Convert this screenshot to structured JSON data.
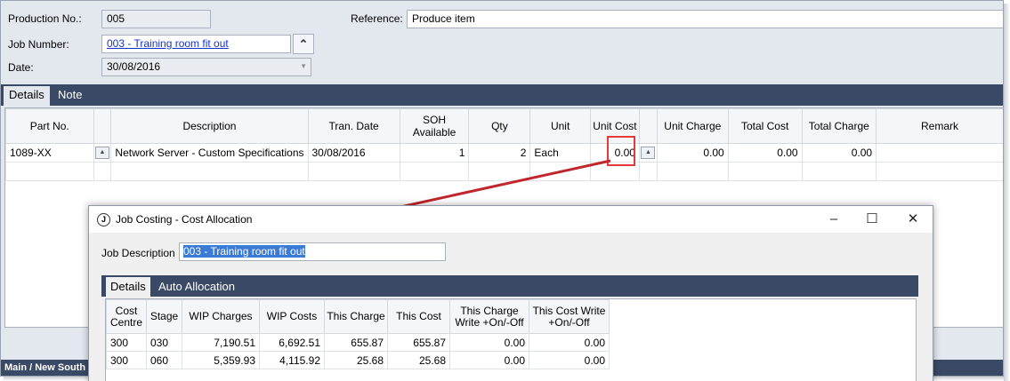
{
  "header": {
    "production_no_label": "Production No.:",
    "production_no_value": "005",
    "job_number_label": "Job Number:",
    "job_number_value": "003 - Training room fit out",
    "date_label": "Date:",
    "date_value": "30/08/2016",
    "reference_label": "Reference:",
    "reference_value": "Produce item"
  },
  "tabs": [
    {
      "label": "Details",
      "active": true
    },
    {
      "label": "Note",
      "active": false
    }
  ],
  "grid": {
    "columns": [
      "Part No.",
      "",
      "Description",
      "Tran. Date",
      "SOH Available",
      "Qty",
      "Unit",
      "Unit Cost",
      "",
      "Unit Charge",
      "Total Cost",
      "Total Charge",
      "Remark"
    ],
    "rows": [
      {
        "part_no": "1089-XX",
        "description": "Network Server - Custom Specifications",
        "tran_date": "30/08/2016",
        "soh": "1",
        "qty": "2",
        "unit": "Each",
        "unit_cost": "0.00",
        "unit_charge": "0.00",
        "total_cost": "0.00",
        "total_charge": "0.00",
        "remark": ""
      }
    ]
  },
  "bottom_bar": {
    "text": "Main / New South"
  },
  "dialog": {
    "icon": "J",
    "title": "Job Costing - Cost Allocation",
    "job_description_label": "Job Description",
    "job_description_value": "003 - Training room fit out",
    "tabs": [
      {
        "label": "Details",
        "active": true
      },
      {
        "label": "Auto Allocation",
        "active": false
      }
    ],
    "columns": [
      "Cost Centre",
      "Stage",
      "WIP Charges",
      "WIP Costs",
      "This Charge",
      "This Cost",
      "This Charge Write +On/-Off",
      "This Cost Write +On/-Off"
    ],
    "rows": [
      [
        "300",
        "030",
        "7,190.51",
        "6,692.51",
        "655.87",
        "655.87",
        "0.00",
        "0.00"
      ],
      [
        "300",
        "060",
        "5,359.93",
        "4,115.92",
        "25.68",
        "25.68",
        "0.00",
        "0.00"
      ]
    ]
  },
  "icons": {
    "collapse": "chevron-up-icon",
    "cell_button": "triangle-up-icon",
    "minimize": "minimize-icon",
    "maximize": "maximize-icon",
    "close": "close-icon"
  },
  "colors": {
    "tab_bar": "#3a4a66",
    "highlight": "#e23b3b",
    "arrow": "#c0262c",
    "link": "#1a33c8"
  }
}
